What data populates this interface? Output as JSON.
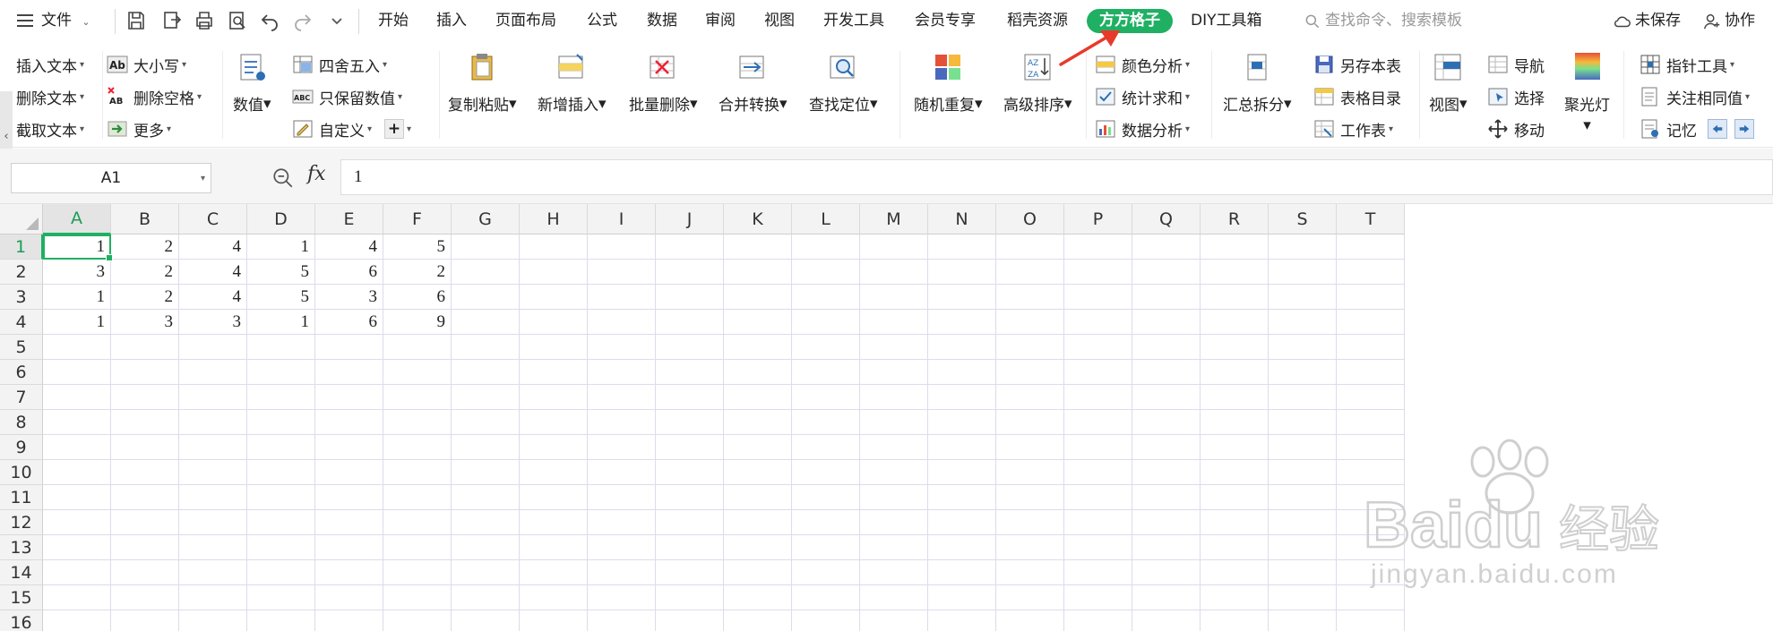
{
  "quick_bar": {
    "file_label": "文件",
    "icons": [
      "hamburger-menu-icon",
      "save-icon",
      "export-icon",
      "print-icon",
      "print-preview-icon",
      "undo-icon",
      "redo-icon",
      "more-icon"
    ]
  },
  "menu_tabs": [
    {
      "label": "开始"
    },
    {
      "label": "插入"
    },
    {
      "label": "页面布局"
    },
    {
      "label": "公式"
    },
    {
      "label": "数据"
    },
    {
      "label": "审阅"
    },
    {
      "label": "视图"
    },
    {
      "label": "开发工具"
    },
    {
      "label": "会员专享"
    },
    {
      "label": "稻壳资源"
    },
    {
      "label": "方方格子"
    },
    {
      "label": "DIY工具箱"
    }
  ],
  "active_tab": "方方格子",
  "search": {
    "placeholder": "查找命令、搜索模板"
  },
  "top_right": {
    "unsaved": "未保存",
    "collab": "协作"
  },
  "ribbon": {
    "text_group": {
      "insert": "插入文本",
      "delete": "删除文本",
      "cut": "截取文本"
    },
    "case_group": {
      "case": "大小写",
      "del_space": "删除空格",
      "more": "更多"
    },
    "number_group": {
      "numeric": "数值",
      "round": "四舍五入",
      "keep_num": "只保留数值",
      "custom": "自定义"
    },
    "big_buttons": {
      "copy_paste": "复制粘贴",
      "new_insert": "新增插入",
      "batch_delete": "批量删除",
      "merge_convert": "合并转换",
      "find_locate": "查找定位",
      "random_repeat": "随机重复",
      "advanced_sort": "高级排序",
      "summary_split": "汇总拆分",
      "view": "视图",
      "spotlight": "聚光灯"
    },
    "analysis_group": {
      "color": "颜色分析",
      "stats": "统计求和",
      "data": "数据分析"
    },
    "sheet_group": {
      "save_sheet": "另存本表",
      "toc": "表格目录",
      "worksheet": "工作表"
    },
    "nav_group": {
      "nav": "导航",
      "select": "选择",
      "move": "移动"
    },
    "pointer_group": {
      "pointer": "指针工具",
      "same_value": "关注相同值",
      "memory": "记忆"
    }
  },
  "formula_bar": {
    "name_box": "A1",
    "fx": "fx",
    "content": "1"
  },
  "sheet": {
    "columns": [
      "A",
      "B",
      "C",
      "D",
      "E",
      "F",
      "G",
      "H",
      "I",
      "J",
      "K",
      "L",
      "M",
      "N",
      "O",
      "P",
      "Q",
      "R",
      "S",
      "T"
    ],
    "rows": [
      "1",
      "2",
      "3",
      "4",
      "5",
      "6",
      "7",
      "8",
      "9",
      "10",
      "11",
      "12",
      "13",
      "14",
      "15",
      "16"
    ],
    "data": [
      [
        "1",
        "2",
        "4",
        "1",
        "4",
        "5"
      ],
      [
        "3",
        "2",
        "4",
        "5",
        "6",
        "2"
      ],
      [
        "1",
        "2",
        "4",
        "5",
        "3",
        "6"
      ],
      [
        "1",
        "3",
        "3",
        "1",
        "6",
        "9"
      ]
    ],
    "active_cell": "A1"
  },
  "watermark": {
    "brand": "Baidu",
    "brand_cn": "经验",
    "url": "jingyan.baidu.com"
  },
  "colors": {
    "accent": "#1fb063",
    "arrow": "#e83a2a"
  }
}
